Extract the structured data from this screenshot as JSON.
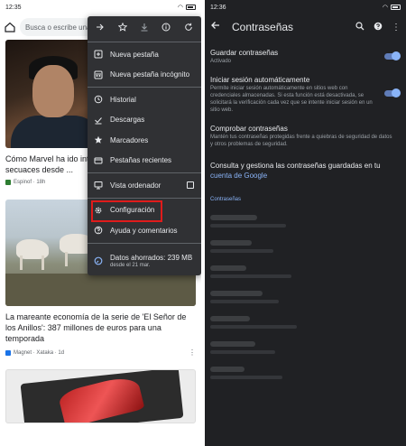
{
  "left": {
    "status_time": "12:35",
    "omnibox_placeholder": "Busca o escribe una",
    "menu": {
      "items": [
        {
          "label": "Nueva pestaña",
          "icon": "new-tab-icon"
        },
        {
          "label": "Nueva pestaña incógnito",
          "icon": "incognito-icon"
        },
        {
          "label": "Historial",
          "icon": "history-icon"
        },
        {
          "label": "Descargas",
          "icon": "download-check-icon"
        },
        {
          "label": "Marcadores",
          "icon": "star-icon"
        },
        {
          "label": "Pestañas recientes",
          "icon": "recent-tabs-icon"
        }
      ],
      "desktop_label": "Vista ordenador",
      "settings_label": "Configuración",
      "help_label": "Ayuda y comentarios",
      "savings_label": "Datos ahorrados: 239 MB",
      "savings_sub": "desde el 21 mar."
    },
    "cards": [
      {
        "title": "Cómo Marvel ha ido int de 'Shang-Chi y la leyen secuaces desde ...",
        "source": "Espinof · 18h"
      },
      {
        "title": "La mareante economía de la serie de 'El Señor de los Anillos': 387 millones de euros para una temporada",
        "source": "Magnet · Xataka · 1d"
      }
    ]
  },
  "right": {
    "status_time": "12:36",
    "title": "Contraseñas",
    "save_title": "Guardar contraseñas",
    "save_sub": "Activado",
    "autosignin_title": "Iniciar sesión automáticamente",
    "autosignin_sub": "Permite iniciar sesión automáticamente en sitios web con credenciales almacenadas. Si esta función está desactivada, se solicitará la verificación cada vez que se intente iniciar sesión en un sitio web.",
    "check_title": "Comprobar contraseñas",
    "check_sub": "Mantén tus contraseñas protegidas frente a quiebras de seguridad de datos y otros problemas de seguridad.",
    "manage_text": "Consulta y gestiona las contraseñas guardadas en tu ",
    "manage_link": "cuenta de Google",
    "section_label": "Contraseñas",
    "save_enabled": true,
    "autosignin_enabled": true
  },
  "colors": {
    "highlight": "#e01b1b",
    "accent": "#8ab4f8"
  }
}
